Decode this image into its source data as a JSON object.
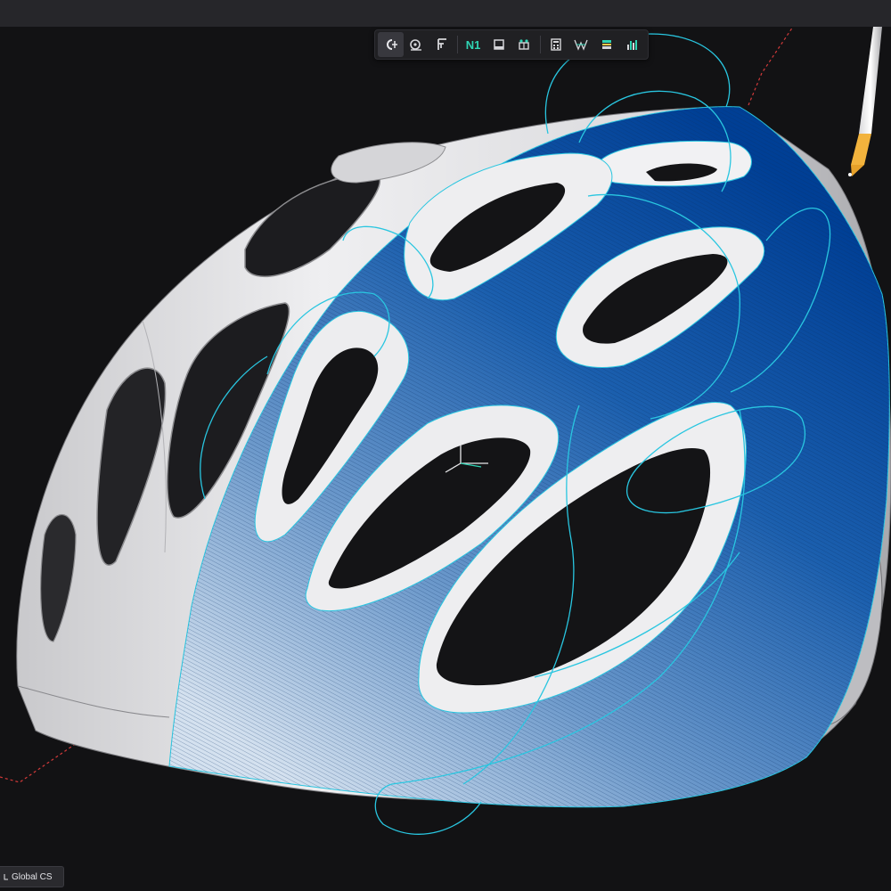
{
  "toolbar": {
    "tools": [
      {
        "name": "curve-tool",
        "icon": "curve-control-points-icon",
        "active": true
      },
      {
        "name": "analysis-tool",
        "icon": "surface-analysis-icon"
      },
      {
        "name": "edit-tool",
        "icon": "caliper-edit-icon"
      },
      {
        "name": "continuity-tool",
        "icon": "n1-continuity-icon",
        "label": "N1"
      },
      {
        "name": "panel-tool",
        "icon": "panel-icon"
      },
      {
        "name": "mesh-tool",
        "icon": "mesh-icon"
      },
      {
        "name": "calculator-tool",
        "icon": "calculator-icon"
      },
      {
        "name": "curvature-tool",
        "icon": "curvature-comb-icon"
      },
      {
        "name": "zebra-tool",
        "icon": "zebra-stripes-icon"
      },
      {
        "name": "graph-tool",
        "icon": "graph-bars-icon"
      }
    ]
  },
  "status": {
    "coordinate_system": "Global CS"
  },
  "colors": {
    "background": "#121214",
    "surface_blue": "#0b4a9a",
    "curve_cyan": "#29c6e0",
    "helmet_white": "#e6e6e8",
    "construction_red": "#d23a3a",
    "teal_accent": "#2fd4b4"
  }
}
